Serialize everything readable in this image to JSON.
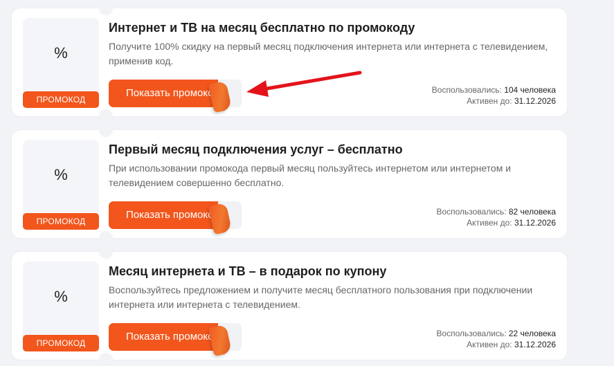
{
  "promos": [
    {
      "percent_symbol": "%",
      "tag": "ПРОМОКОД",
      "title": "Интернет и ТВ на месяц бесплатно по промокоду",
      "description": "Получите 100% скидку на первый месяц подключения интернета или интернета с телевидением, применив код.",
      "button": "Показать промокод",
      "used_label": "Воспользовались:",
      "used_value": "104 человека",
      "active_label": "Активен до:",
      "active_value": "31.12.2026"
    },
    {
      "percent_symbol": "%",
      "tag": "ПРОМОКОД",
      "title": "Первый месяц подключения услуг – бесплатно",
      "description": "При использовании промокода первый месяц пользуйтесь интернетом или интернетом и телевидением совершенно бесплатно.",
      "button": "Показать промокод",
      "used_label": "Воспользовались:",
      "used_value": "82 человека",
      "active_label": "Активен до:",
      "active_value": "31.12.2026"
    },
    {
      "percent_symbol": "%",
      "tag": "ПРОМОКОД",
      "title": "Месяц интернета и ТВ – в подарок по купону",
      "description": "Воспользуйтесь предложением и получите месяц бесплатного пользования при подключении интернета или интернета с телевидением.",
      "button": "Показать промокод",
      "used_label": "Воспользовались:",
      "used_value": "22 человека",
      "active_label": "Активен до:",
      "active_value": "31.12.2026"
    }
  ],
  "colors": {
    "accent": "#f2561c",
    "arrow": "#e3131b",
    "background": "#f2f3f6",
    "card": "#ffffff"
  },
  "annotation": {
    "icon": "red-arrow-icon"
  }
}
